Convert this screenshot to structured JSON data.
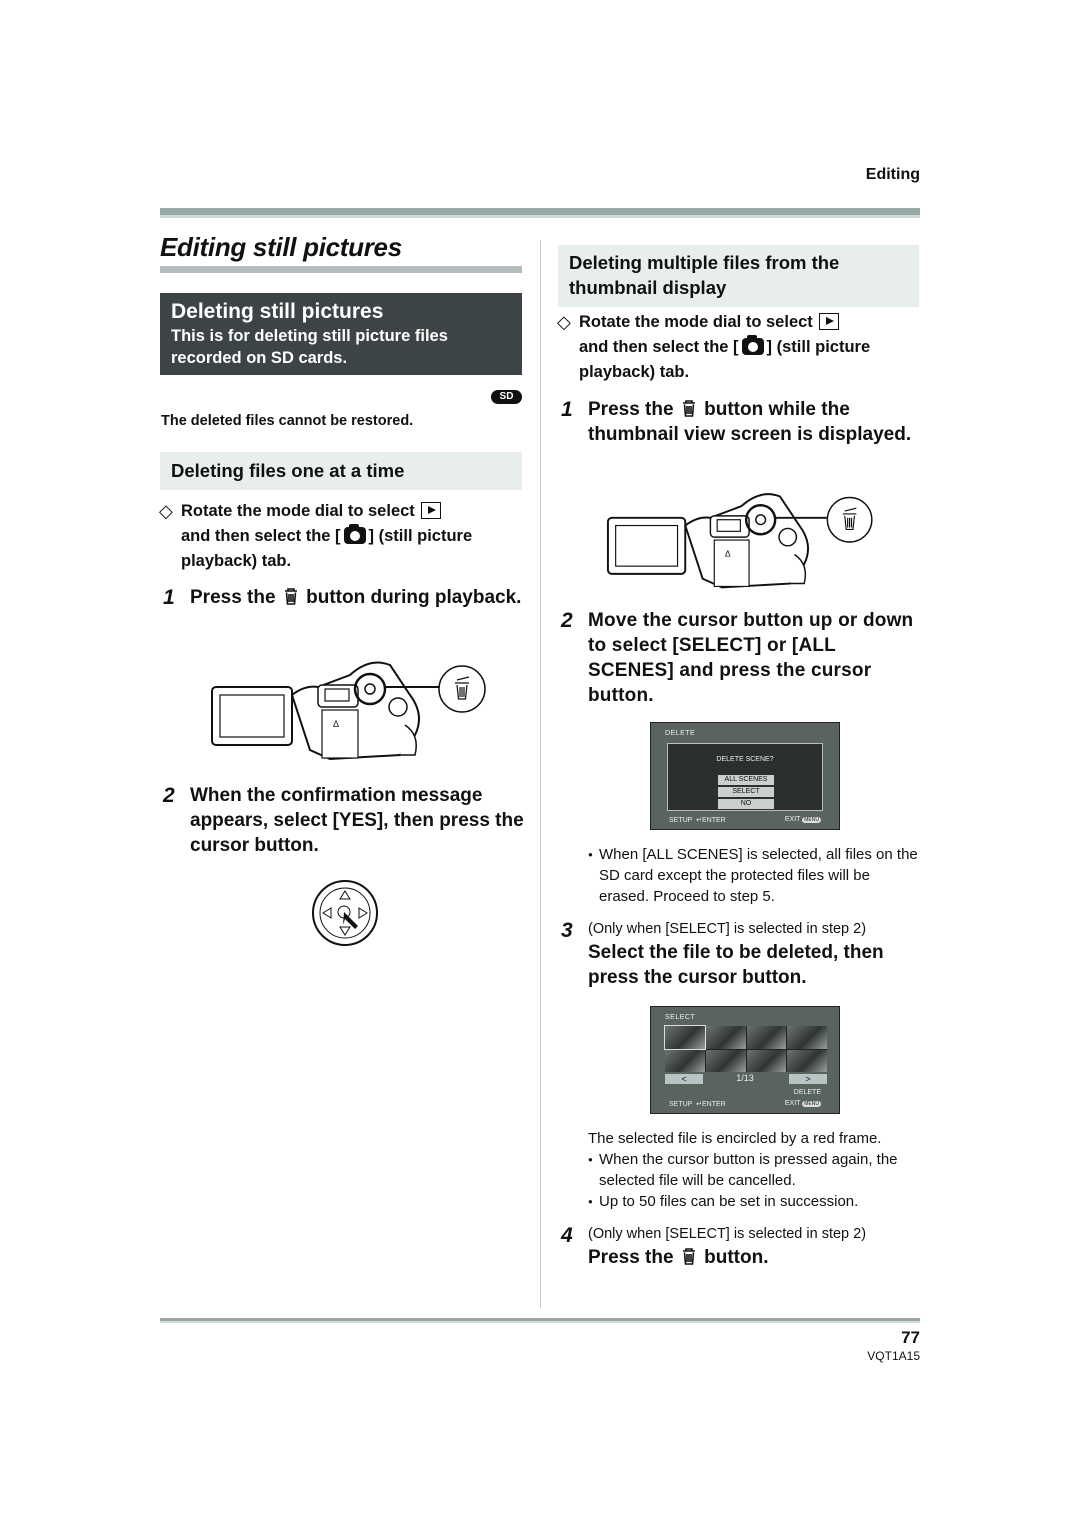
{
  "header": {
    "running_head": "Editing"
  },
  "page_title": "Editing still pictures",
  "section": {
    "title": "Deleting still pictures",
    "subtitle": "This is for deleting still picture files recorded on SD cards.",
    "media_badge": "SD",
    "warning": "The deleted files cannot be restored."
  },
  "left": {
    "heading": "Deleting files one at a time",
    "prereq": {
      "marker": "◇",
      "part1": "Rotate the mode dial to select",
      "part2": "and then select the [",
      "part3": "] (still picture playback) tab."
    },
    "steps": [
      {
        "num": "1",
        "pre": "Press the",
        "post": "button during playback."
      },
      {
        "num": "2",
        "text": "When the confirmation message appears, select [YES], then press the cursor button."
      }
    ]
  },
  "right": {
    "heading": "Deleting multiple files from the thumbnail display",
    "prereq": {
      "marker": "◇",
      "part1": "Rotate the mode dial to select",
      "part2": "and then select the [",
      "part3": "] (still picture playback) tab."
    },
    "steps": [
      {
        "num": "1",
        "pre": "Press the",
        "post": "button while the thumbnail view screen is displayed."
      },
      {
        "num": "2",
        "text": "Move the cursor button up or down to select [SELECT] or [ALL SCENES] and press the cursor button."
      },
      {
        "num": "3",
        "note": "(Only when [SELECT] is selected in step 2)",
        "text": "Select the file to be deleted, then press the cursor button."
      },
      {
        "num": "4",
        "note": "(Only when [SELECT] is selected in step 2)",
        "pre": "Press the",
        "post": "button."
      }
    ],
    "bullets_after_step2": [
      "When [ALL SCENES] is selected, all files on the SD card except the protected files will be erased. Proceed to step 5."
    ],
    "after_step3_text": "The selected file is encircled by a red frame.",
    "bullets_after_step3": [
      "When the cursor button is pressed again, the selected file will be cancelled.",
      "Up to 50 files can be set in succession."
    ]
  },
  "screen_delete": {
    "title": "DELETE",
    "question": "DELETE SCENE?",
    "options": [
      "ALL SCENES",
      "SELECT",
      "NO"
    ],
    "footer_left": "SETUP",
    "footer_enter": "ENTER",
    "footer_right": "EXIT",
    "menu_pill": "MENU"
  },
  "screen_select": {
    "title": "SELECT",
    "page": "1/13",
    "prev": "<",
    "next": ">",
    "delete_label": "DELETE",
    "footer_left": "SETUP",
    "footer_enter": "ENTER",
    "footer_right": "EXIT",
    "menu_pill": "MENU"
  },
  "footer": {
    "page_number": "77",
    "doc_code": "VQT1A15"
  }
}
